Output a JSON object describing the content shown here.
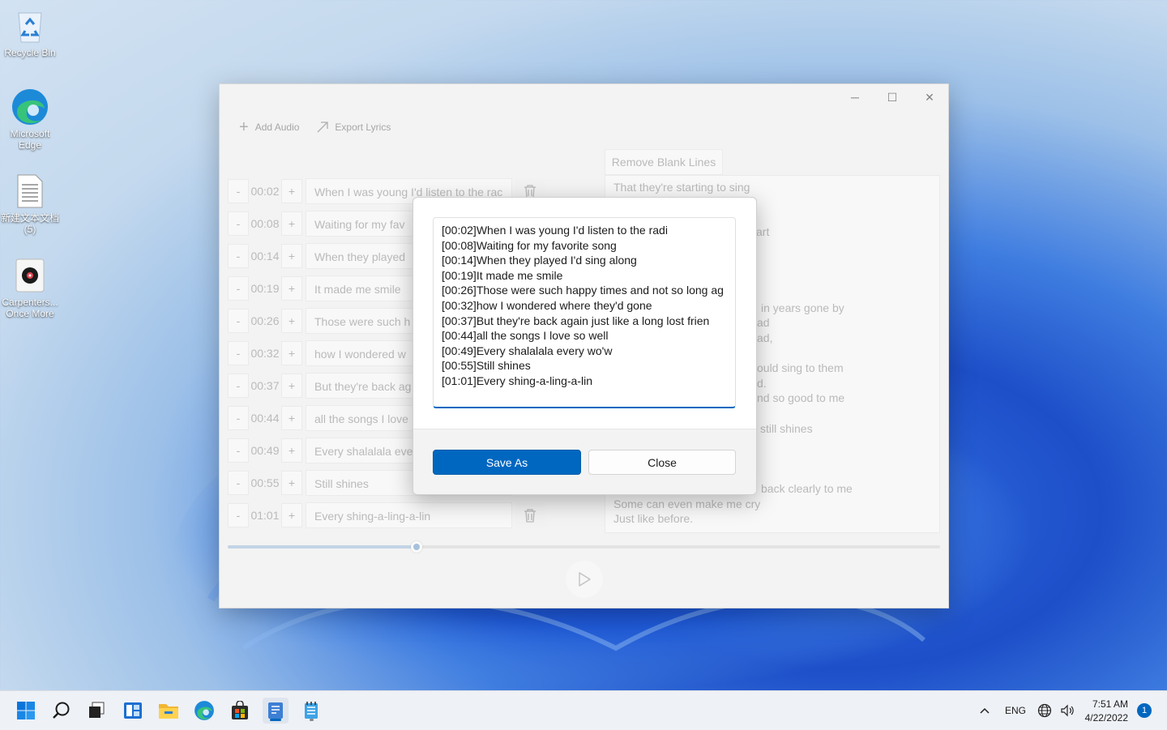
{
  "desktop": {
    "icons": [
      {
        "label": "Recycle Bin"
      },
      {
        "label": "Microsoft Edge"
      },
      {
        "label": "新建文本文档 (5)"
      },
      {
        "label": "Carpenters... Once More"
      }
    ]
  },
  "window": {
    "controls": {
      "minimize": "─",
      "maximize": "☐",
      "close": "✕"
    },
    "toolbar": {
      "add_audio": "Add Audio",
      "export_lyrics": "Export Lyrics"
    },
    "remove_blank_lines": "Remove Blank Lines",
    "rows": [
      {
        "minus": "-",
        "time": "00:02",
        "plus": "+",
        "text": "When I was young I'd listen to the rac"
      },
      {
        "minus": "-",
        "time": "00:08",
        "plus": "+",
        "text": "Waiting for my fav"
      },
      {
        "minus": "-",
        "time": "00:14",
        "plus": "+",
        "text": "When they played"
      },
      {
        "minus": "-",
        "time": "00:19",
        "plus": "+",
        "text": "It made me smile"
      },
      {
        "minus": "-",
        "time": "00:26",
        "plus": "+",
        "text": "Those were such h"
      },
      {
        "minus": "-",
        "time": "00:32",
        "plus": "+",
        "text": "how I wondered w"
      },
      {
        "minus": "-",
        "time": "00:37",
        "plus": "+",
        "text": "But they're back ag"
      },
      {
        "minus": "-",
        "time": "00:44",
        "plus": "+",
        "text": "all the songs I love"
      },
      {
        "minus": "-",
        "time": "00:49",
        "plus": "+",
        "text": "Every shalalala eve"
      },
      {
        "minus": "-",
        "time": "00:55",
        "plus": "+",
        "text": "Still shines"
      },
      {
        "minus": "-",
        "time": "01:01",
        "plus": "+",
        "text": "Every shing-a-ling-a-lin"
      }
    ],
    "right_lines": [
      "That they're starting to sing",
      "art",
      "in years gone by",
      "ad",
      "ad,",
      "ould sing to them",
      "d.",
      "nd so good to me",
      "still shines",
      "back clearly to me",
      "Some can even make me cry",
      "Just like before."
    ],
    "progress": 0.265
  },
  "dialog": {
    "lines": [
      "[00:02]When I was young I'd listen to the radi",
      "[00:08]Waiting for my favorite song",
      "[00:14]When they played I'd sing along",
      "[00:19]It made me smile",
      "[00:26]Those were such happy times and not so long ag",
      "[00:32]how I wondered where they'd gone",
      "[00:37]But they're back again just like a long lost frien",
      "[00:44]all the songs I love so well",
      "[00:49]Every shalalala every wo'w",
      "[00:55]Still shines",
      "[01:01]Every shing-a-ling-a-lin"
    ],
    "save_as": "Save As",
    "close": "Close"
  },
  "taskbar": {
    "lang": "ENG",
    "time": "7:51 AM",
    "date": "4/22/2022",
    "notifications": "1"
  },
  "colors": {
    "accent": "#0067c0"
  }
}
